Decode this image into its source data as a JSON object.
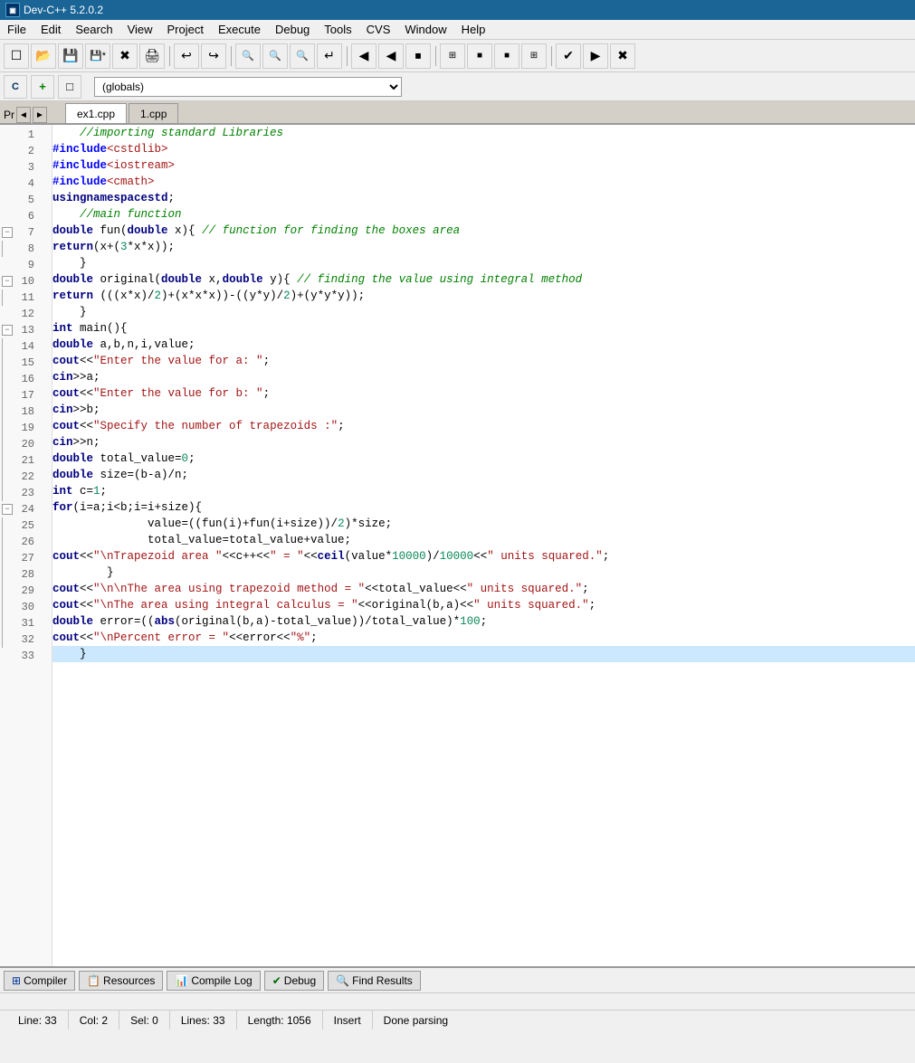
{
  "titlebar": {
    "title": "Dev-C++ 5.2.0.2",
    "icon": "Dev"
  },
  "menu": {
    "items": [
      "File",
      "Edit",
      "Search",
      "View",
      "Project",
      "Execute",
      "Debug",
      "Tools",
      "CVS",
      "Window",
      "Help"
    ]
  },
  "toolbar2": {
    "dropdown_value": "(globals)",
    "dropdown_placeholder": "(globals)"
  },
  "tabs": {
    "project_label": "Pr",
    "items": [
      "ex1.cpp",
      "1.cpp"
    ]
  },
  "code": {
    "lines": [
      {
        "num": 1,
        "fold": null,
        "indent_bar": false,
        "text": "    //importing standard Libraries",
        "type": "comment"
      },
      {
        "num": 2,
        "fold": null,
        "indent_bar": false,
        "text": "    #include <cstdlib>",
        "type": "pp"
      },
      {
        "num": 3,
        "fold": null,
        "indent_bar": false,
        "text": "    #include <iostream>",
        "type": "pp"
      },
      {
        "num": 4,
        "fold": null,
        "indent_bar": false,
        "text": "    #include <cmath>",
        "type": "pp"
      },
      {
        "num": 5,
        "fold": null,
        "indent_bar": false,
        "text": "    using namespace std;",
        "type": "normal"
      },
      {
        "num": 6,
        "fold": null,
        "indent_bar": false,
        "text": "    //main function",
        "type": "comment"
      },
      {
        "num": 7,
        "fold": "minus",
        "indent_bar": false,
        "text": "    double fun(double x){ // function for finding the boxes area",
        "type": "mixed"
      },
      {
        "num": 8,
        "fold": null,
        "indent_bar": true,
        "text": "        return(x+(3*x*x));",
        "type": "normal"
      },
      {
        "num": 9,
        "fold": null,
        "indent_bar": false,
        "text": "    }",
        "type": "normal"
      },
      {
        "num": 10,
        "fold": "minus",
        "indent_bar": false,
        "text": "    double original(double x,double y){ // finding the value using integral method",
        "type": "mixed"
      },
      {
        "num": 11,
        "fold": null,
        "indent_bar": true,
        "text": "        return (((x*x)/2)+(x*x*x))-((y*y)/2)+(y*y*y));",
        "type": "normal"
      },
      {
        "num": 12,
        "fold": null,
        "indent_bar": false,
        "text": "    }",
        "type": "normal"
      },
      {
        "num": 13,
        "fold": "minus",
        "indent_bar": false,
        "text": "    int main(){",
        "type": "mixed"
      },
      {
        "num": 14,
        "fold": null,
        "indent_bar": true,
        "text": "        double a,b,n,i,value;",
        "type": "normal"
      },
      {
        "num": 15,
        "fold": null,
        "indent_bar": true,
        "text": "        cout<<\"Enter the value for a: \";",
        "type": "normal"
      },
      {
        "num": 16,
        "fold": null,
        "indent_bar": true,
        "text": "        cin>>a;",
        "type": "normal"
      },
      {
        "num": 17,
        "fold": null,
        "indent_bar": true,
        "text": "        cout<<\"Enter the value for b: \";",
        "type": "normal"
      },
      {
        "num": 18,
        "fold": null,
        "indent_bar": true,
        "text": "        cin>>b;",
        "type": "normal"
      },
      {
        "num": 19,
        "fold": null,
        "indent_bar": true,
        "text": "        cout<<\"Specify the number of trapezoids :\";",
        "type": "normal"
      },
      {
        "num": 20,
        "fold": null,
        "indent_bar": true,
        "text": "        cin>>n;",
        "type": "normal"
      },
      {
        "num": 21,
        "fold": null,
        "indent_bar": true,
        "text": "        double total_value=0;",
        "type": "normal"
      },
      {
        "num": 22,
        "fold": null,
        "indent_bar": true,
        "text": "        double size=(b-a)/n;",
        "type": "normal"
      },
      {
        "num": 23,
        "fold": null,
        "indent_bar": true,
        "text": "        int c=1;",
        "type": "normal"
      },
      {
        "num": 24,
        "fold": "minus",
        "indent_bar": true,
        "text": "        for(i=a;i<b;i=i+size){",
        "type": "mixed"
      },
      {
        "num": 25,
        "fold": null,
        "indent_bar": true,
        "text": "              value=((fun(i)+fun(i+size))/2)*size;",
        "type": "normal"
      },
      {
        "num": 26,
        "fold": null,
        "indent_bar": true,
        "text": "              total_value=total_value+value;",
        "type": "normal"
      },
      {
        "num": 27,
        "fold": null,
        "indent_bar": true,
        "text": "              cout<<\"\\nTrapezoid area \"<<c++<<\" = \"<<ceil(value*10000)/10000<<\" units squared.\";",
        "type": "normal"
      },
      {
        "num": 28,
        "fold": null,
        "indent_bar": true,
        "text": "        }",
        "type": "normal"
      },
      {
        "num": 29,
        "fold": null,
        "indent_bar": true,
        "text": "        cout<<\"\\n\\nThe area using trapezoid method = \"<<total_value<<\" units squared.\";",
        "type": "normal"
      },
      {
        "num": 30,
        "fold": null,
        "indent_bar": true,
        "text": "        cout<<\"\\nThe area using integral calculus = \"<<original(b,a)<<\" units squared.\";",
        "type": "normal"
      },
      {
        "num": 31,
        "fold": null,
        "indent_bar": true,
        "text": "        double error=((abs(original(b,a)-total_value))/total_value)*100;",
        "type": "normal"
      },
      {
        "num": 32,
        "fold": null,
        "indent_bar": true,
        "text": "        cout<<\"\\nPercent error = \"<<error<<\"%\";",
        "type": "normal"
      },
      {
        "num": 33,
        "fold": null,
        "indent_bar": false,
        "text": "    }",
        "type": "normal",
        "highlighted": true
      }
    ]
  },
  "bottom_tabs": [
    {
      "label": "Compiler",
      "icon": "compiler"
    },
    {
      "label": "Resources",
      "icon": "resources"
    },
    {
      "label": "Compile Log",
      "icon": "compile-log"
    },
    {
      "label": "Debug",
      "icon": "debug"
    },
    {
      "label": "Find Results",
      "icon": "find-results"
    }
  ],
  "status_bar": {
    "line_label": "Line:",
    "line_val": "33",
    "col_label": "Col:",
    "col_val": "2",
    "sel_label": "Sel:",
    "sel_val": "0",
    "lines_label": "Lines:",
    "lines_val": "33",
    "length_label": "Length:",
    "length_val": "1056",
    "mode": "Insert",
    "status": "Done parsing"
  }
}
